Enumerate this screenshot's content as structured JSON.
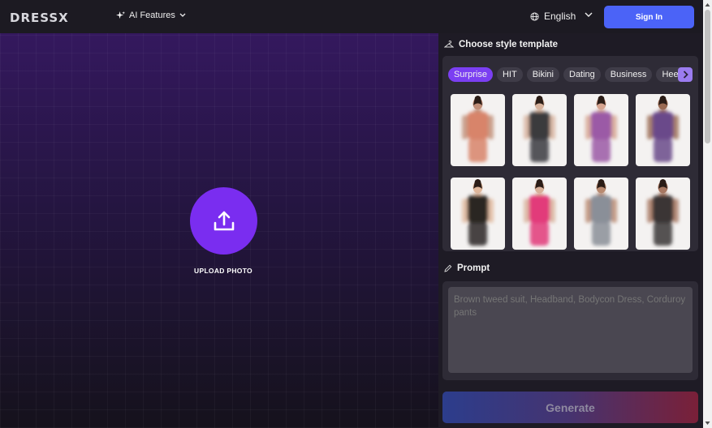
{
  "header": {
    "logo": "DRESSX",
    "ai_features": "AI Features",
    "language": "English",
    "sign_in": "Sign In"
  },
  "upload": {
    "label": "UPLOAD PHOTO"
  },
  "templates": {
    "title": "Choose style template",
    "chips": [
      "Surprise",
      "HIT",
      "Bikini",
      "Dating",
      "Business",
      "Heels"
    ],
    "active_chip": "Surprise",
    "thumbnails": [
      {
        "outfit": "red-orange dress",
        "color": "#d8846a",
        "skin": "#c08e78"
      },
      {
        "outfit": "black suit",
        "color": "#3a3a3e",
        "skin": "#d7b29c"
      },
      {
        "outfit": "purple bikini",
        "color": "#9b5aa6",
        "skin": "#d6a48f"
      },
      {
        "outfit": "purple swimsuit",
        "color": "#6a4a8a",
        "skin": "#9a6a52"
      },
      {
        "outfit": "black lace outfit",
        "color": "#2a2624",
        "skin": "#e0b79b"
      },
      {
        "outfit": "pink swimsuit",
        "color": "#e23a7a",
        "skin": "#d8b09a"
      },
      {
        "outfit": "grey t-shirt",
        "color": "#8a8f98",
        "skin": "#b98a70"
      },
      {
        "outfit": "black dress",
        "color": "#3a3535",
        "skin": "#a87862"
      }
    ]
  },
  "prompt": {
    "title": "Prompt",
    "placeholder": "Brown tweed suit, Headband, Bodycon Dress, Corduroy pants"
  },
  "generate": {
    "label": "Generate"
  },
  "colors": {
    "accent": "#7b3ff2",
    "signin": "#4b63f7",
    "upload": "#7a2df0"
  }
}
